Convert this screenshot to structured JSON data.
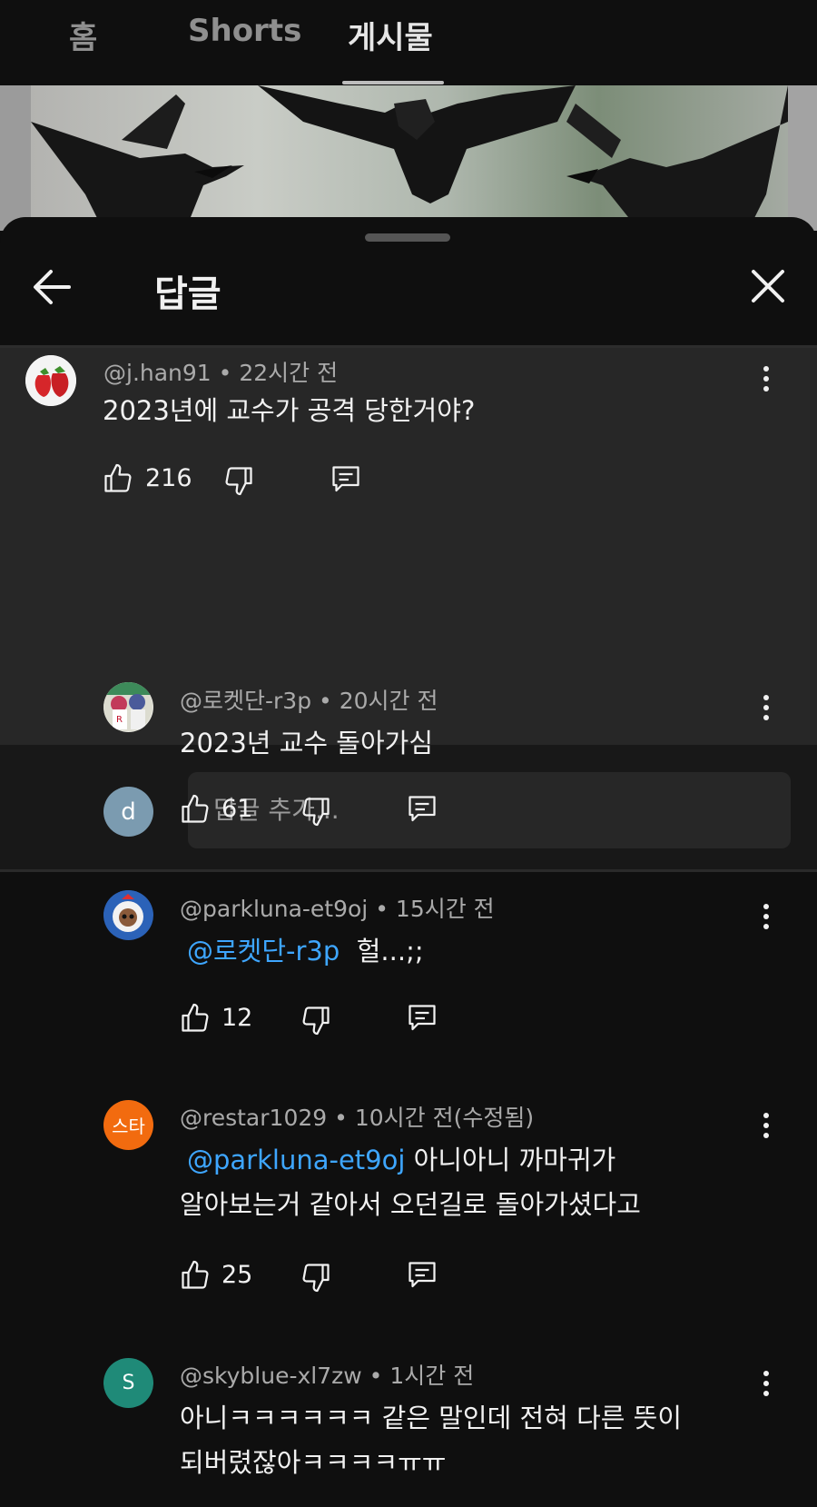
{
  "tabs": [
    {
      "label": "홈",
      "active": false
    },
    {
      "label": "Shorts",
      "active": false
    },
    {
      "label": "게시물",
      "active": true
    }
  ],
  "sheet": {
    "title": "답글",
    "back_icon": "arrow-left-icon",
    "close_icon": "close-icon"
  },
  "parent_comment": {
    "author": "@j.han91",
    "time": "22시간 전",
    "text": "2023년에 교수가 공격 당한거야?",
    "likes": "216"
  },
  "reply_input": {
    "avatar_letter": "d",
    "placeholder": "답글 추가..."
  },
  "replies": [
    {
      "author": "@로켓단-r3p",
      "time": "20시간 전",
      "mention": "",
      "text": "2023년 교수 돌아가심",
      "text2": "",
      "likes": "61"
    },
    {
      "author": "@parkluna-et9oj",
      "time": "15시간 전",
      "mention": "@로켓단-r3p",
      "text": "헐...;;",
      "text2": "",
      "likes": "12"
    },
    {
      "author": "@restar1029",
      "time": "10시간 전(수정됨)",
      "mention": "@parkluna-et9oj",
      "text": "아니아니 까마귀가",
      "text2": "알아보는거 같아서 오던길로 돌아가셨다고",
      "likes": "25",
      "avatar_text": "스타"
    },
    {
      "author": "@skyblue-xl7zw",
      "time": "1시간 전",
      "mention": "",
      "text": "아니ㅋㅋㅋㅋㅋㅋ 같은 말인데 전혀 다른 뜻이",
      "text2": "되버렸잖아ㅋㅋㅋㅋㅠㅠ",
      "likes": "",
      "avatar_text": "S"
    }
  ],
  "colors": {
    "background": "#0f0f0f",
    "parent_highlight": "#272727",
    "mention": "#3ea6ff",
    "avatar_restar": "#f26b0f",
    "avatar_skyblue": "#1f8a78",
    "avatar_user": "#7b9bb0"
  }
}
